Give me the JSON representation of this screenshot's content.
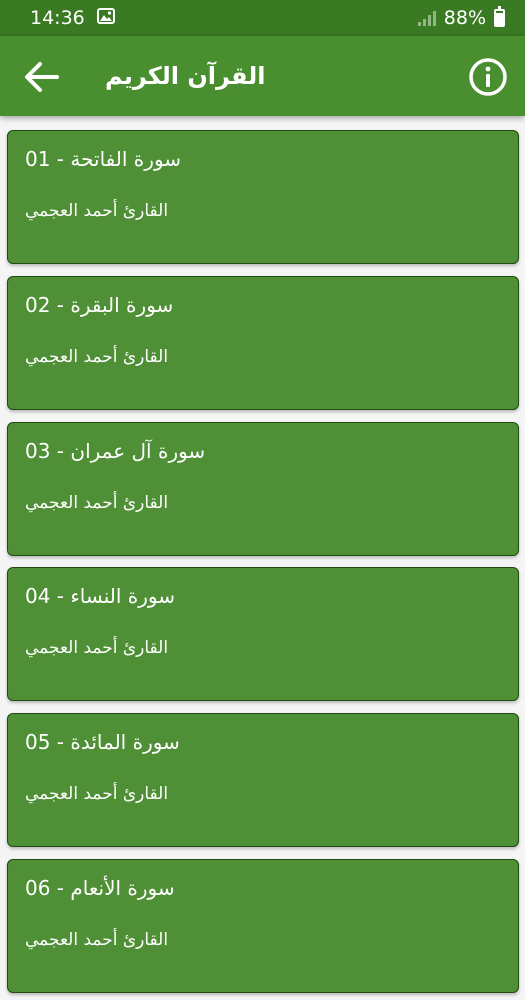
{
  "status_bar": {
    "time": "14:36",
    "battery": "88%",
    "icons": [
      "image-icon",
      "signal-icon",
      "battery-icon"
    ]
  },
  "app_bar": {
    "title": "القرآن الكريم",
    "back_icon": "arrow-left-icon",
    "info_icon": "info-icon"
  },
  "colors": {
    "status_bar": "#3a7a23",
    "app_bar": "#4a8f2f",
    "card": "#4f8f36",
    "card_border": "#1e4d0f",
    "background": "#f5f5f5"
  },
  "surahs": [
    {
      "title": "سورة الفاتحة - 01",
      "reader": "القارئ أحمد العجمي"
    },
    {
      "title": "سورة البقرة - 02",
      "reader": "القارئ أحمد العجمي"
    },
    {
      "title": "سورة آل عمران - 03",
      "reader": "القارئ أحمد العجمي"
    },
    {
      "title": "سورة النساء - 04",
      "reader": "القارئ أحمد العجمي"
    },
    {
      "title": "سورة المائدة - 05",
      "reader": "القارئ أحمد العجمي"
    },
    {
      "title": "سورة الأنعام - 06",
      "reader": "القارئ أحمد العجمي"
    }
  ]
}
